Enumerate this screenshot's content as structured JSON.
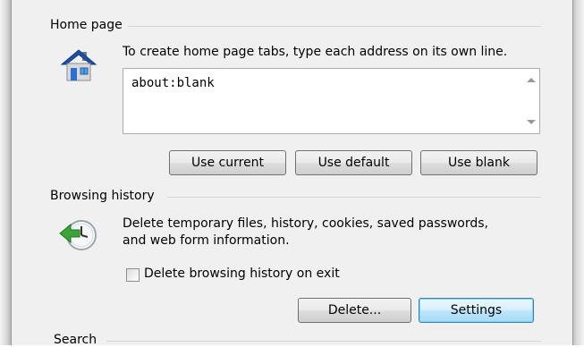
{
  "home_page": {
    "group_label": "Home page",
    "instruction": "To create home page tabs, type each address on its own line.",
    "address_value": "about:blank",
    "buttons": {
      "use_current": "Use current",
      "use_default": "Use default",
      "use_blank": "Use blank"
    },
    "icon": "house-icon"
  },
  "browsing_history": {
    "group_label": "Browsing history",
    "description_line1": "Delete temporary files, history, cookies, saved passwords,",
    "description_line2": "and web form information.",
    "checkbox_label": "Delete browsing history on exit",
    "checkbox_checked": false,
    "buttons": {
      "delete": "Delete...",
      "settings": "Settings"
    },
    "icon": "clock-history-icon"
  },
  "search": {
    "group_label": "Search"
  }
}
